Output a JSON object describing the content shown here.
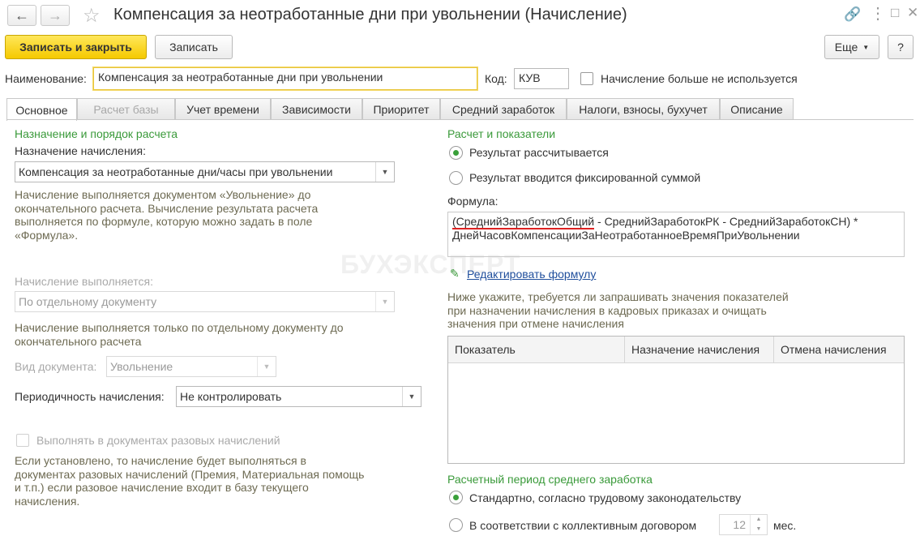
{
  "window": {
    "title": "Компенсация за неотработанные дни при увольнении (Начисление)"
  },
  "toolbar": {
    "save_close": "Записать и закрыть",
    "save": "Записать",
    "more": "Еще",
    "help": "?"
  },
  "header": {
    "name_label": "Наименование:",
    "name_value": "Компенсация за неотработанные дни при увольнении",
    "code_label": "Код:",
    "code_value": "КУВ",
    "not_used_label": "Начисление больше не используется"
  },
  "tabs": [
    {
      "label": "Основное"
    },
    {
      "label": "Расчет базы"
    },
    {
      "label": "Учет времени"
    },
    {
      "label": "Зависимости"
    },
    {
      "label": "Приоритет"
    },
    {
      "label": "Средний заработок"
    },
    {
      "label": "Налоги, взносы, бухучет"
    },
    {
      "label": "Описание"
    }
  ],
  "left": {
    "section_title": "Назначение и порядок расчета",
    "purpose_label": "Назначение начисления:",
    "purpose_value": "Компенсация за неотработанные дни/часы при увольнении",
    "purpose_note": [
      "Начисление выполняется документом «Увольнение» до",
      "окончательного расчета. Вычисление результата расчета",
      "выполняется по формуле, которую можно задать в поле",
      "«Формула»."
    ],
    "execution_label": "Начисление выполняется:",
    "execution_value": "По отдельному документу",
    "execution_note": [
      "Начисление выполняется только по отдельному документу до",
      "окончательного расчета"
    ],
    "doc_type_label": "Вид документа:",
    "doc_type_value": "Увольнение",
    "periodicity_label": "Периодичность начисления:",
    "periodicity_value": "Не контролировать",
    "one_time_label": "Выполнять в документах разовых начислений",
    "one_time_note": [
      "Если установлено, то начисление будет выполняться в",
      "документах разовых начислений (Премия, Материальная помощь",
      "и т.п.) если разовое начисление входит в базу текущего",
      "начисления."
    ]
  },
  "right": {
    "section_title": "Расчет и показатели",
    "radio_calculated": "Результат рассчитывается",
    "radio_fixed": "Результат вводится фиксированной суммой",
    "formula_label": "Формула:",
    "formula_part1": "(СреднийЗаработокОбщий",
    "formula_part2": " - СреднийЗаработокРК - СреднийЗаработокСН) *",
    "formula_line2": "ДнейЧасовКомпенсацииЗаНеотработанноеВремяПриУвольнении",
    "edit_formula": "Редактировать формулу",
    "indicators_note": [
      "Ниже укажите, требуется ли запрашивать значения показателей",
      "при назначении начисления в кадровых приказах и очищать",
      "значения при отмене начисления"
    ],
    "grid_headers": [
      "Показатель",
      "Назначение начисления",
      "Отмена начисления"
    ],
    "period_title": "Расчетный период среднего заработка",
    "radio_standard": "Стандартно, согласно трудовому законодательству",
    "radio_collective": "В соответствии с коллективным договором",
    "months_value": "12",
    "months_unit": "мес."
  },
  "watermark": "БУХЭКСПЕРТ",
  "colors": {
    "accent_green": "#3a9a3a",
    "primary_yellow": "#f5c900",
    "link_blue": "#1f4e9c",
    "note_olive": "#6d6a52"
  }
}
